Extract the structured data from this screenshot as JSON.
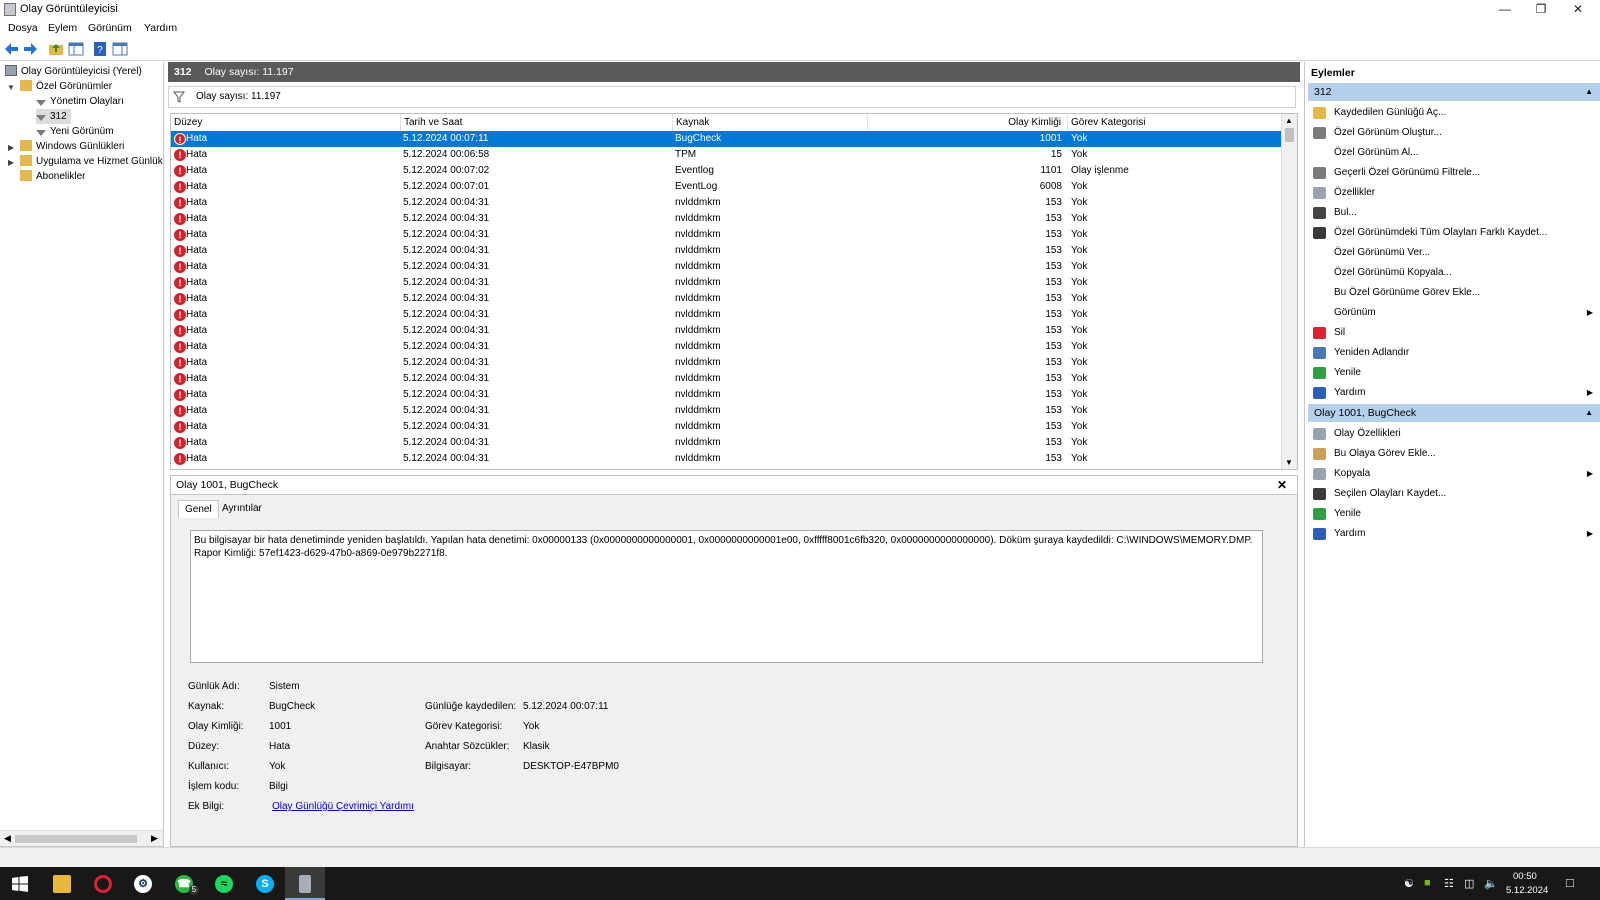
{
  "window": {
    "title": "Olay Görüntüleyicisi"
  },
  "menu": [
    "Dosya",
    "Eylem",
    "Görünüm",
    "Yardım"
  ],
  "toolbar": [
    "back-icon",
    "forward-icon",
    "folder-up-icon",
    "show-hide-tree-icon",
    "help-icon",
    "properties-pane-icon"
  ],
  "tree": {
    "root": "Olay Görüntüleyicisi (Yerel)",
    "custom_views": "Özel Görünümler",
    "admin_events": "Yönetim Olayları",
    "view_312": "312",
    "new_view": "Yeni Görünüm",
    "windows_logs": "Windows Günlükleri",
    "app_service_logs": "Uygulama ve Hizmet Günlük",
    "subscriptions": "Abonelikler"
  },
  "center": {
    "header_name": "312",
    "header_count": "Olay sayısı: 11.197",
    "filter_text": "Olay sayısı: 11.197",
    "columns": [
      "Düzey",
      "Tarih ve Saat",
      "Kaynak",
      "Olay Kimliği",
      "Görev Kategorisi"
    ],
    "rows": [
      [
        "Hata",
        "5.12.2024 00:07:11",
        "BugCheck",
        "1001",
        "Yok"
      ],
      [
        "Hata",
        "5.12.2024 00:06:58",
        "TPM",
        "15",
        "Yok"
      ],
      [
        "Hata",
        "5.12.2024 00:07:02",
        "Eventlog",
        "1101",
        "Olay işlenme"
      ],
      [
        "Hata",
        "5.12.2024 00:07:01",
        "EventLog",
        "6008",
        "Yok"
      ],
      [
        "Hata",
        "5.12.2024 00:04:31",
        "nvlddmkm",
        "153",
        "Yok"
      ],
      [
        "Hata",
        "5.12.2024 00:04:31",
        "nvlddmkm",
        "153",
        "Yok"
      ],
      [
        "Hata",
        "5.12.2024 00:04:31",
        "nvlddmkm",
        "153",
        "Yok"
      ],
      [
        "Hata",
        "5.12.2024 00:04:31",
        "nvlddmkm",
        "153",
        "Yok"
      ],
      [
        "Hata",
        "5.12.2024 00:04:31",
        "nvlddmkm",
        "153",
        "Yok"
      ],
      [
        "Hata",
        "5.12.2024 00:04:31",
        "nvlddmkm",
        "153",
        "Yok"
      ],
      [
        "Hata",
        "5.12.2024 00:04:31",
        "nvlddmkm",
        "153",
        "Yok"
      ],
      [
        "Hata",
        "5.12.2024 00:04:31",
        "nvlddmkm",
        "153",
        "Yok"
      ],
      [
        "Hata",
        "5.12.2024 00:04:31",
        "nvlddmkm",
        "153",
        "Yok"
      ],
      [
        "Hata",
        "5.12.2024 00:04:31",
        "nvlddmkm",
        "153",
        "Yok"
      ],
      [
        "Hata",
        "5.12.2024 00:04:31",
        "nvlddmkm",
        "153",
        "Yok"
      ],
      [
        "Hata",
        "5.12.2024 00:04:31",
        "nvlddmkm",
        "153",
        "Yok"
      ],
      [
        "Hata",
        "5.12.2024 00:04:31",
        "nvlddmkm",
        "153",
        "Yok"
      ],
      [
        "Hata",
        "5.12.2024 00:04:31",
        "nvlddmkm",
        "153",
        "Yok"
      ],
      [
        "Hata",
        "5.12.2024 00:04:31",
        "nvlddmkm",
        "153",
        "Yok"
      ],
      [
        "Hata",
        "5.12.2024 00:04:31",
        "nvlddmkm",
        "153",
        "Yok"
      ],
      [
        "Hata",
        "5.12.2024 00:04:31",
        "nvlddmkm",
        "153",
        "Yok"
      ]
    ]
  },
  "details": {
    "title": "Olay 1001, BugCheck",
    "tabs": [
      "Genel",
      "Ayrıntılar"
    ],
    "description": "Bu bilgisayar bir hata denetiminde yeniden başlatıldı. Yapılan hata denetimi: 0x00000133 (0x0000000000000001, 0x0000000000001e00, 0xfffff8001c6fb320, 0x0000000000000000). Döküm şuraya kaydedildi: C:\\WINDOWS\\MEMORY.DMP. Rapor Kimliği: 57ef1423-d629-47b0-a869-0e979b2271f8.",
    "fields": {
      "log_name_label": "Günlük Adı:",
      "log_name": "Sistem",
      "source_label": "Kaynak:",
      "source": "BugCheck",
      "logged_label": "Günlüğe kaydedilen:",
      "logged": "5.12.2024 00:07:11",
      "event_id_label": "Olay Kimliği:",
      "event_id": "1001",
      "task_label": "Görev Kategorisi:",
      "task": "Yok",
      "level_label": "Düzey:",
      "level": "Hata",
      "keywords_label": "Anahtar Sözcükler:",
      "keywords": "Klasik",
      "user_label": "Kullanıcı:",
      "user": "Yok",
      "computer_label": "Bilgisayar:",
      "computer": "DESKTOP-E47BPM0",
      "opcode_label": "İşlem kodu:",
      "opcode": "Bilgi",
      "more_info_label": "Ek Bilgi:",
      "more_info": "Olay Günlüğü Çevrimiçi Yardımı"
    }
  },
  "actions": {
    "title": "Eylemler",
    "section1": "312",
    "items1": [
      {
        "label": "Kaydedilen Günlüğü Aç...",
        "icon": "open-log-icon"
      },
      {
        "label": "Özel Görünüm Oluştur...",
        "icon": "create-view-icon"
      },
      {
        "label": "Özel Görünüm Al...",
        "icon": ""
      },
      {
        "label": "Geçerli Özel Görünümü Filtrele...",
        "icon": "filter-icon"
      },
      {
        "label": "Özellikler",
        "icon": "properties-icon"
      },
      {
        "label": "Bul...",
        "icon": "find-icon"
      },
      {
        "label": "Özel Görünümdeki Tüm Olayları Farklı Kaydet...",
        "icon": "save-icon"
      },
      {
        "label": "Özel Görünümü Ver...",
        "icon": ""
      },
      {
        "label": "Özel Görünümü Kopyala...",
        "icon": ""
      },
      {
        "label": "Bu Özel Görünüme Görev Ekle...",
        "icon": ""
      },
      {
        "label": "Görünüm",
        "icon": "",
        "sub": true
      },
      {
        "label": "Sil",
        "icon": "delete-icon"
      },
      {
        "label": "Yeniden Adlandır",
        "icon": "rename-icon"
      },
      {
        "label": "Yenile",
        "icon": "refresh-icon"
      },
      {
        "label": "Yardım",
        "icon": "help-icon",
        "sub": true
      }
    ],
    "section2": "Olay 1001, BugCheck",
    "items2": [
      {
        "label": "Olay Özellikleri",
        "icon": "event-properties-icon"
      },
      {
        "label": "Bu Olaya Görev Ekle...",
        "icon": "attach-task-icon"
      },
      {
        "label": "Kopyala",
        "icon": "copy-icon",
        "sub": true
      },
      {
        "label": "Seçilen Olayları Kaydet...",
        "icon": "save-icon"
      },
      {
        "label": "Yenile",
        "icon": "refresh-icon"
      },
      {
        "label": "Yardım",
        "icon": "help-icon",
        "sub": true
      }
    ]
  },
  "taskbar": {
    "apps": [
      "start-icon",
      "file-explorer-icon",
      "opera-icon",
      "steam-icon",
      "whatsapp-icon",
      "spotify-icon",
      "skype-icon",
      "event-viewer-icon"
    ],
    "whatsapp_badge": "5",
    "time": "00:50",
    "date": "5.12.2024"
  }
}
